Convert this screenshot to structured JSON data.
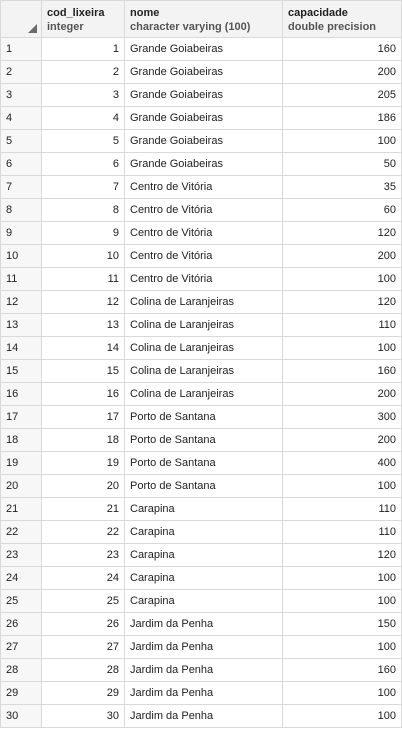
{
  "columns": [
    {
      "name": "cod_lixeira",
      "type": "integer"
    },
    {
      "name": "nome",
      "type": "character varying (100)"
    },
    {
      "name": "capacidade",
      "type": "double precision"
    }
  ],
  "rows": [
    {
      "n": "1",
      "cod": "1",
      "nome": "Grande Goiabeiras",
      "cap": "160"
    },
    {
      "n": "2",
      "cod": "2",
      "nome": "Grande Goiabeiras",
      "cap": "200"
    },
    {
      "n": "3",
      "cod": "3",
      "nome": "Grande Goiabeiras",
      "cap": "205"
    },
    {
      "n": "4",
      "cod": "4",
      "nome": "Grande Goiabeiras",
      "cap": "186"
    },
    {
      "n": "5",
      "cod": "5",
      "nome": "Grande Goiabeiras",
      "cap": "100"
    },
    {
      "n": "6",
      "cod": "6",
      "nome": "Grande Goiabeiras",
      "cap": "50"
    },
    {
      "n": "7",
      "cod": "7",
      "nome": "Centro de Vitória",
      "cap": "35"
    },
    {
      "n": "8",
      "cod": "8",
      "nome": "Centro de Vitória",
      "cap": "60"
    },
    {
      "n": "9",
      "cod": "9",
      "nome": "Centro de Vitória",
      "cap": "120"
    },
    {
      "n": "10",
      "cod": "10",
      "nome": "Centro de Vitória",
      "cap": "200"
    },
    {
      "n": "11",
      "cod": "11",
      "nome": "Centro de Vitória",
      "cap": "100"
    },
    {
      "n": "12",
      "cod": "12",
      "nome": "Colina de Laranjeiras",
      "cap": "120"
    },
    {
      "n": "13",
      "cod": "13",
      "nome": "Colina de Laranjeiras",
      "cap": "110"
    },
    {
      "n": "14",
      "cod": "14",
      "nome": "Colina de Laranjeiras",
      "cap": "100"
    },
    {
      "n": "15",
      "cod": "15",
      "nome": "Colina de Laranjeiras",
      "cap": "160"
    },
    {
      "n": "16",
      "cod": "16",
      "nome": "Colina de Laranjeiras",
      "cap": "200"
    },
    {
      "n": "17",
      "cod": "17",
      "nome": "Porto de Santana",
      "cap": "300"
    },
    {
      "n": "18",
      "cod": "18",
      "nome": "Porto de Santana",
      "cap": "200"
    },
    {
      "n": "19",
      "cod": "19",
      "nome": "Porto de Santana",
      "cap": "400"
    },
    {
      "n": "20",
      "cod": "20",
      "nome": "Porto de Santana",
      "cap": "100"
    },
    {
      "n": "21",
      "cod": "21",
      "nome": "Carapina",
      "cap": "110"
    },
    {
      "n": "22",
      "cod": "22",
      "nome": "Carapina",
      "cap": "110"
    },
    {
      "n": "23",
      "cod": "23",
      "nome": "Carapina",
      "cap": "120"
    },
    {
      "n": "24",
      "cod": "24",
      "nome": "Carapina",
      "cap": "100"
    },
    {
      "n": "25",
      "cod": "25",
      "nome": "Carapina",
      "cap": "100"
    },
    {
      "n": "26",
      "cod": "26",
      "nome": "Jardim da Penha",
      "cap": "150"
    },
    {
      "n": "27",
      "cod": "27",
      "nome": "Jardim da Penha",
      "cap": "100"
    },
    {
      "n": "28",
      "cod": "28",
      "nome": "Jardim da Penha",
      "cap": "160"
    },
    {
      "n": "29",
      "cod": "29",
      "nome": "Jardim da Penha",
      "cap": "100"
    },
    {
      "n": "30",
      "cod": "30",
      "nome": "Jardim da Penha",
      "cap": "100"
    }
  ]
}
